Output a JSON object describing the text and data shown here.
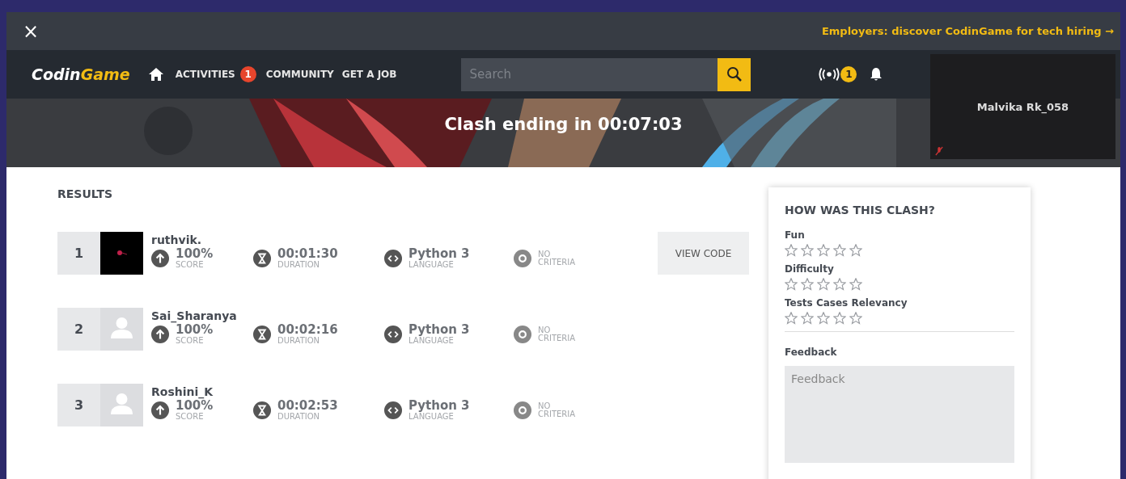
{
  "top_bar": {
    "close": "×",
    "promo": "Employers: discover CodinGame for tech hiring →"
  },
  "nav": {
    "logo_a": "Codin",
    "logo_b": "Game",
    "items": [
      {
        "label": "ACTIVITIES",
        "badge": "1"
      },
      {
        "label": "COMMUNITY"
      },
      {
        "label": "GET A JOB"
      }
    ],
    "search": {
      "placeholder": "Search"
    },
    "live_badge": "1"
  },
  "overlay": {
    "name": "Malvika Rk_058"
  },
  "banner": {
    "title": "Clash ending in 00:07:03"
  },
  "results": {
    "title": "RESULTS",
    "rows": [
      {
        "rank": "1",
        "name": "ruthvik.",
        "score": "100%",
        "score_label": "SCORE",
        "duration": "00:01:30",
        "duration_label": "DURATION",
        "language": "Python 3",
        "language_label": "LANGUAGE",
        "criteria": "NO",
        "criteria_label": "CRITERIA",
        "action": "VIEW CODE"
      },
      {
        "rank": "2",
        "name": "Sai_Sharanya",
        "kind": "default",
        "score": "100%",
        "score_label": "SCORE",
        "duration": "00:02:16",
        "duration_label": "DURATION",
        "language": "Python 3",
        "language_label": "LANGUAGE",
        "criteria": "NO",
        "criteria_label": "CRITERIA"
      },
      {
        "rank": "3",
        "name": "Roshini_K",
        "kind": "default",
        "score": "100%",
        "score_label": "SCORE",
        "duration": "00:02:53",
        "duration_label": "DURATION",
        "language": "Python 3",
        "language_label": "LANGUAGE",
        "criteria": "NO",
        "criteria_label": "CRITERIA"
      }
    ]
  },
  "rating": {
    "title": "HOW WAS THIS CLASH?",
    "criteria": [
      {
        "label": "Fun",
        "stars": 0
      },
      {
        "label": "Difficulty",
        "stars": 0
      },
      {
        "label": "Tests Cases Relevancy",
        "stars": 0
      }
    ],
    "feedback_label": "Feedback",
    "feedback": {
      "placeholder": "Feedback"
    }
  }
}
